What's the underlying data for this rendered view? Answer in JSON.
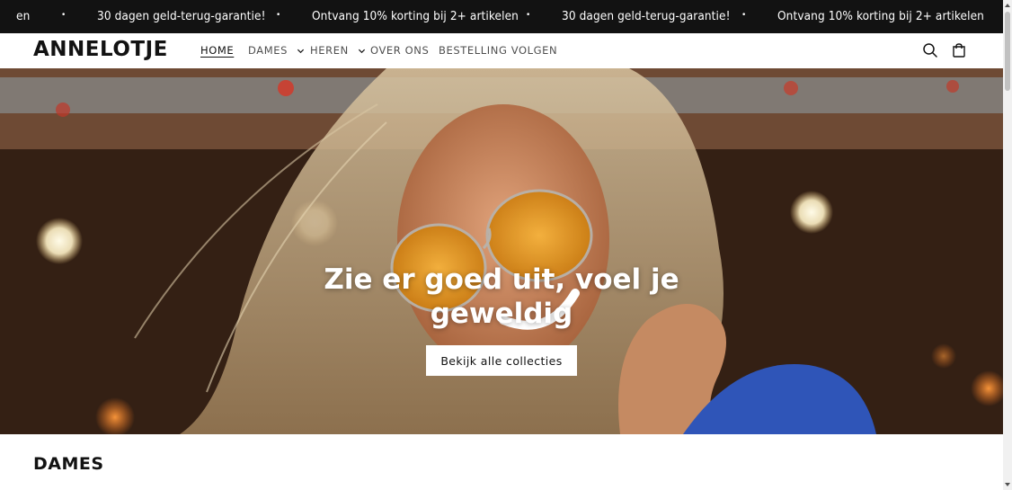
{
  "announcement": {
    "items": [
      "en",
      "30 dagen geld-terug-garantie!",
      "Ontvang 10% korting bij 2+ artikelen",
      "30 dagen geld-terug-garantie!",
      "Ontvang 10% korting bij 2+ artikelen"
    ],
    "separator": "•"
  },
  "header": {
    "logo": "ANNELOTJE",
    "nav": [
      {
        "label": "HOME"
      },
      {
        "label": "DAMES"
      },
      {
        "label": "HEREN"
      },
      {
        "label": "OVER ONS"
      },
      {
        "label": "BESTELLING VOLGEN"
      }
    ],
    "icons": [
      "search-icon",
      "cart-icon"
    ]
  },
  "hero": {
    "title_line1": "Zie er goed uit, voel je",
    "title_line2": "geweldig",
    "button": "Bekijk alle collecties"
  },
  "section": {
    "title": "DAMES"
  },
  "colors": {
    "announcement_bg": "#121212",
    "text": "#121212",
    "button_bg": "#ffffff"
  }
}
